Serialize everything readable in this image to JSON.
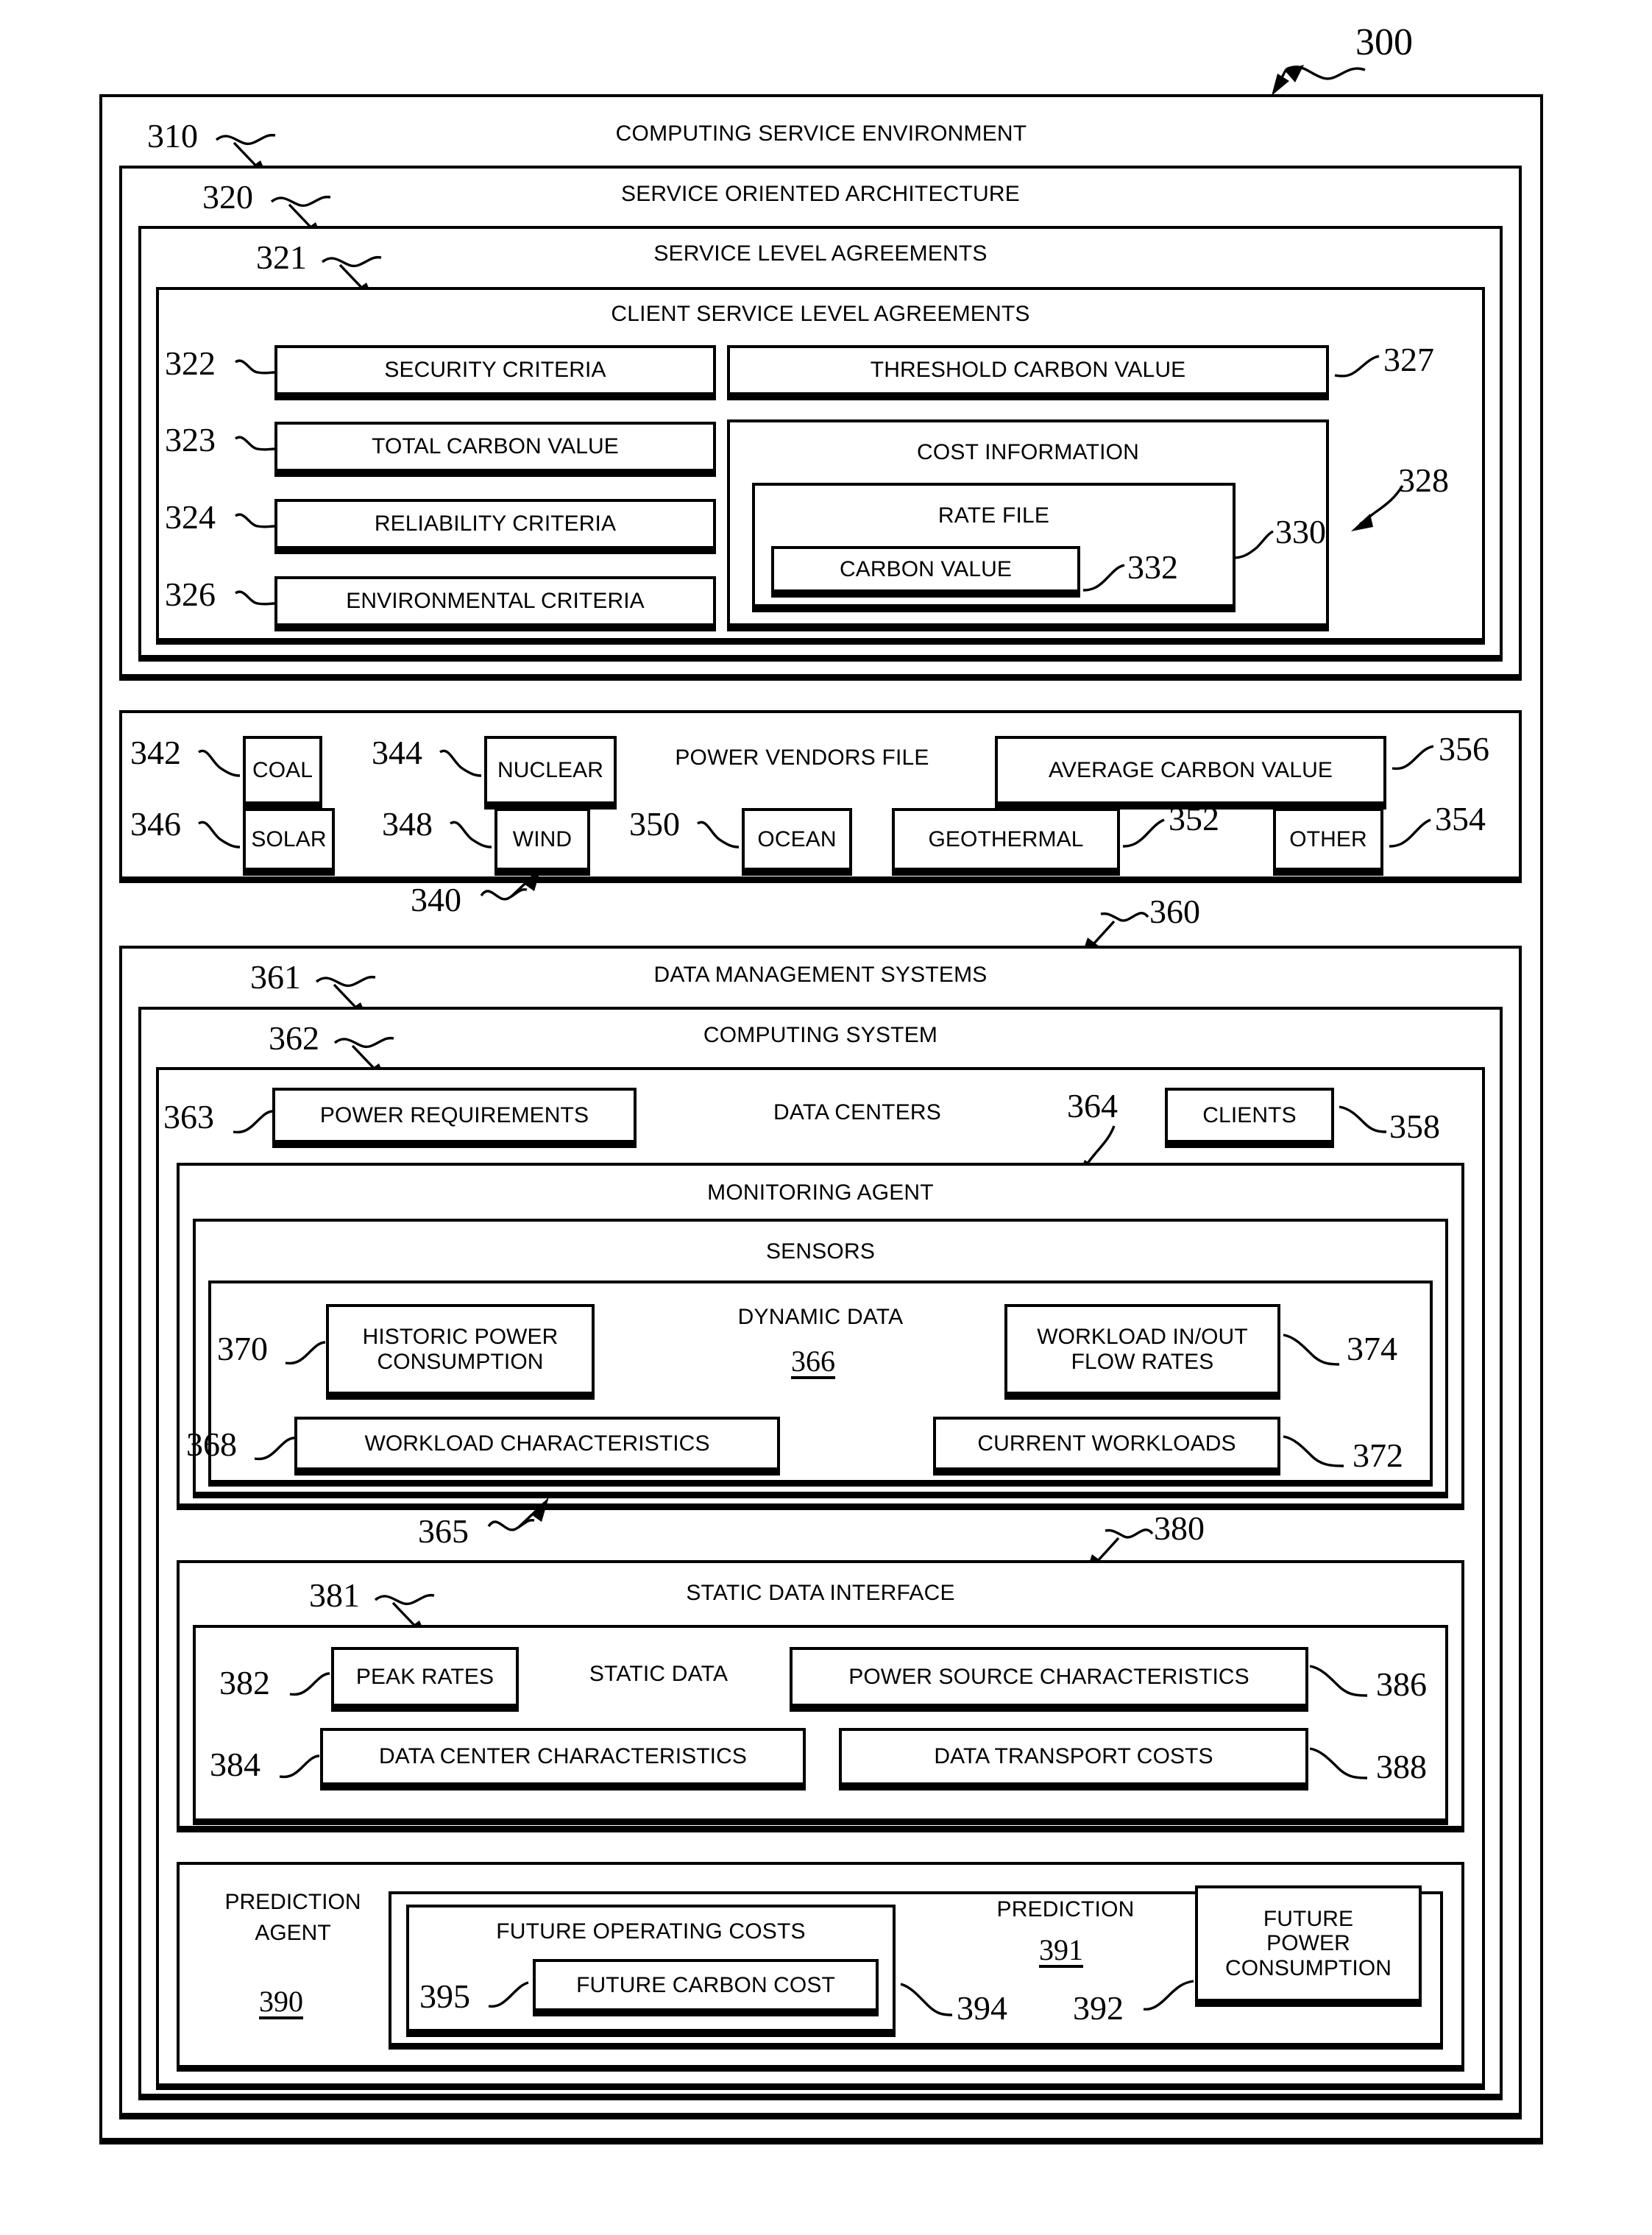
{
  "figure": {
    "number": "300"
  },
  "outer": {
    "ref": "310",
    "title": "COMPUTING SERVICE ENVIRONMENT"
  },
  "soa": {
    "ref": "320",
    "title": "SERVICE ORIENTED ARCHITECTURE"
  },
  "sla": {
    "ref": "321",
    "title": "SERVICE LEVEL AGREEMENTS"
  },
  "client_sla": {
    "title": "CLIENT SERVICE LEVEL AGREEMENTS",
    "left_items": [
      {
        "ref": "322",
        "label": "SECURITY CRITERIA"
      },
      {
        "ref": "323",
        "label": "TOTAL CARBON VALUE"
      },
      {
        "ref": "324",
        "label": "RELIABILITY CRITERIA"
      },
      {
        "ref": "326",
        "label": "ENVIRONMENTAL CRITERIA"
      }
    ],
    "threshold": {
      "ref": "327",
      "label": "THRESHOLD CARBON VALUE"
    },
    "cost_information": {
      "ref": "328",
      "title": "COST INFORMATION",
      "rate_file": {
        "ref": "330",
        "title": "RATE FILE",
        "carbon_value": {
          "ref": "332",
          "label": "CARBON VALUE"
        }
      }
    }
  },
  "power_vendors": {
    "ref": "340",
    "title": "POWER VENDORS FILE",
    "row1": [
      {
        "ref": "342",
        "label": "COAL"
      },
      {
        "ref": "344",
        "label": "NUCLEAR"
      }
    ],
    "average_carbon_value": {
      "ref": "356",
      "label": "AVERAGE CARBON VALUE"
    },
    "row2": [
      {
        "ref": "346",
        "label": "SOLAR"
      },
      {
        "ref": "348",
        "label": "WIND"
      },
      {
        "ref": "350",
        "label": "OCEAN"
      },
      {
        "ref": "352",
        "label": "GEOTHERMAL"
      },
      {
        "ref": "354",
        "label": "OTHER"
      }
    ]
  },
  "data_management": {
    "ref": "360",
    "title": "DATA MANAGEMENT SYSTEMS"
  },
  "computing_system": {
    "ref": "361",
    "title": "COMPUTING SYSTEM"
  },
  "data_centers": {
    "ref": "362",
    "title": "DATA CENTERS",
    "power_requirements": {
      "ref": "363",
      "label": "POWER REQUIREMENTS"
    },
    "clients": {
      "ref": "358",
      "label": "CLIENTS"
    }
  },
  "monitoring_agent": {
    "ref": "364",
    "title": "MONITORING AGENT"
  },
  "sensors": {
    "ref": "365",
    "title": "SENSORS"
  },
  "dynamic_data": {
    "ref": "366",
    "title": "DYNAMIC DATA",
    "items": [
      {
        "ref": "370",
        "label": "HISTORIC POWER CONSUMPTION"
      },
      {
        "ref": "374",
        "label": "WORKLOAD IN/OUT FLOW RATES"
      },
      {
        "ref": "368",
        "label": "WORKLOAD CHARACTERISTICS"
      },
      {
        "ref": "372",
        "label": "CURRENT WORKLOADS"
      }
    ]
  },
  "static_data_interface": {
    "ref": "380",
    "title": "STATIC DATA INTERFACE"
  },
  "static_data": {
    "ref": "381",
    "title": "STATIC DATA",
    "items": [
      {
        "ref": "382",
        "label": "PEAK RATES"
      },
      {
        "ref": "386",
        "label": "POWER SOURCE CHARACTERISTICS"
      },
      {
        "ref": "384",
        "label": "DATA CENTER CHARACTERISTICS"
      },
      {
        "ref": "388",
        "label": "DATA TRANSPORT COSTS"
      }
    ]
  },
  "prediction_agent": {
    "ref": "390",
    "title_line1": "PREDICTION",
    "title_line2": "AGENT"
  },
  "prediction": {
    "ref": "391",
    "title": "PREDICTION",
    "future_operating_costs": {
      "ref": "394",
      "label": "FUTURE OPERATING COSTS",
      "future_carbon_cost": {
        "ref": "395",
        "label": "FUTURE CARBON COST"
      }
    },
    "future_power_consumption": {
      "ref": "392",
      "line1": "FUTURE",
      "line2": "POWER",
      "line3": "CONSUMPTION"
    }
  }
}
